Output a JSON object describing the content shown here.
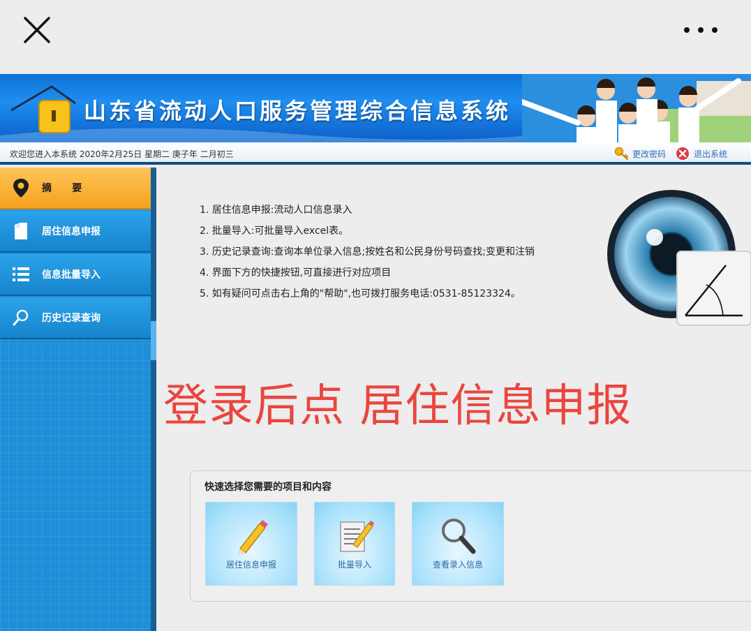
{
  "topbar": {
    "close_icon": "close-icon",
    "more_icon": "more-icon"
  },
  "banner": {
    "title": "山东省流动人口服务管理综合信息系统"
  },
  "welcome": {
    "text": "欢迎您进入本系统 2020年2月25日 星期二 庚子年 二月初三",
    "change_password": "更改密码",
    "logout": "退出系统"
  },
  "sidebar": {
    "items": [
      {
        "label": "摘      要",
        "icon": "map-pin-icon",
        "active": true
      },
      {
        "label": "居住信息申报",
        "icon": "document-icon",
        "active": false
      },
      {
        "label": "信息批量导入",
        "icon": "list-icon",
        "active": false
      },
      {
        "label": "历史记录查询",
        "icon": "search-icon",
        "active": false
      }
    ]
  },
  "main": {
    "instructions": [
      "1. 居住信息申报:流动人口信息录入",
      "2. 批量导入:可批量导入excel表。",
      "3. 历史记录查询:查询本单位录入信息;按姓名和公民身份号码查找;变更和注销",
      "4. 界面下方的快捷按钮,可直接进行对应项目",
      "5. 如有疑问可点击右上角的\"帮助\",也可拨打服务电话:0531-85123324。"
    ],
    "overlay_text": "登录后点  居住信息申报",
    "quick": {
      "title": "快速选择您需要的项目和内容",
      "buttons": [
        {
          "label": "居住信息申报",
          "icon": "pencil-icon"
        },
        {
          "label": "批量导入",
          "icon": "notepad-icon"
        },
        {
          "label": "查看录入信息",
          "icon": "magnifier-icon"
        }
      ]
    }
  },
  "colors": {
    "accent": "#1e8fd8",
    "active": "#f5a21c",
    "overlay": "#e9463f"
  }
}
